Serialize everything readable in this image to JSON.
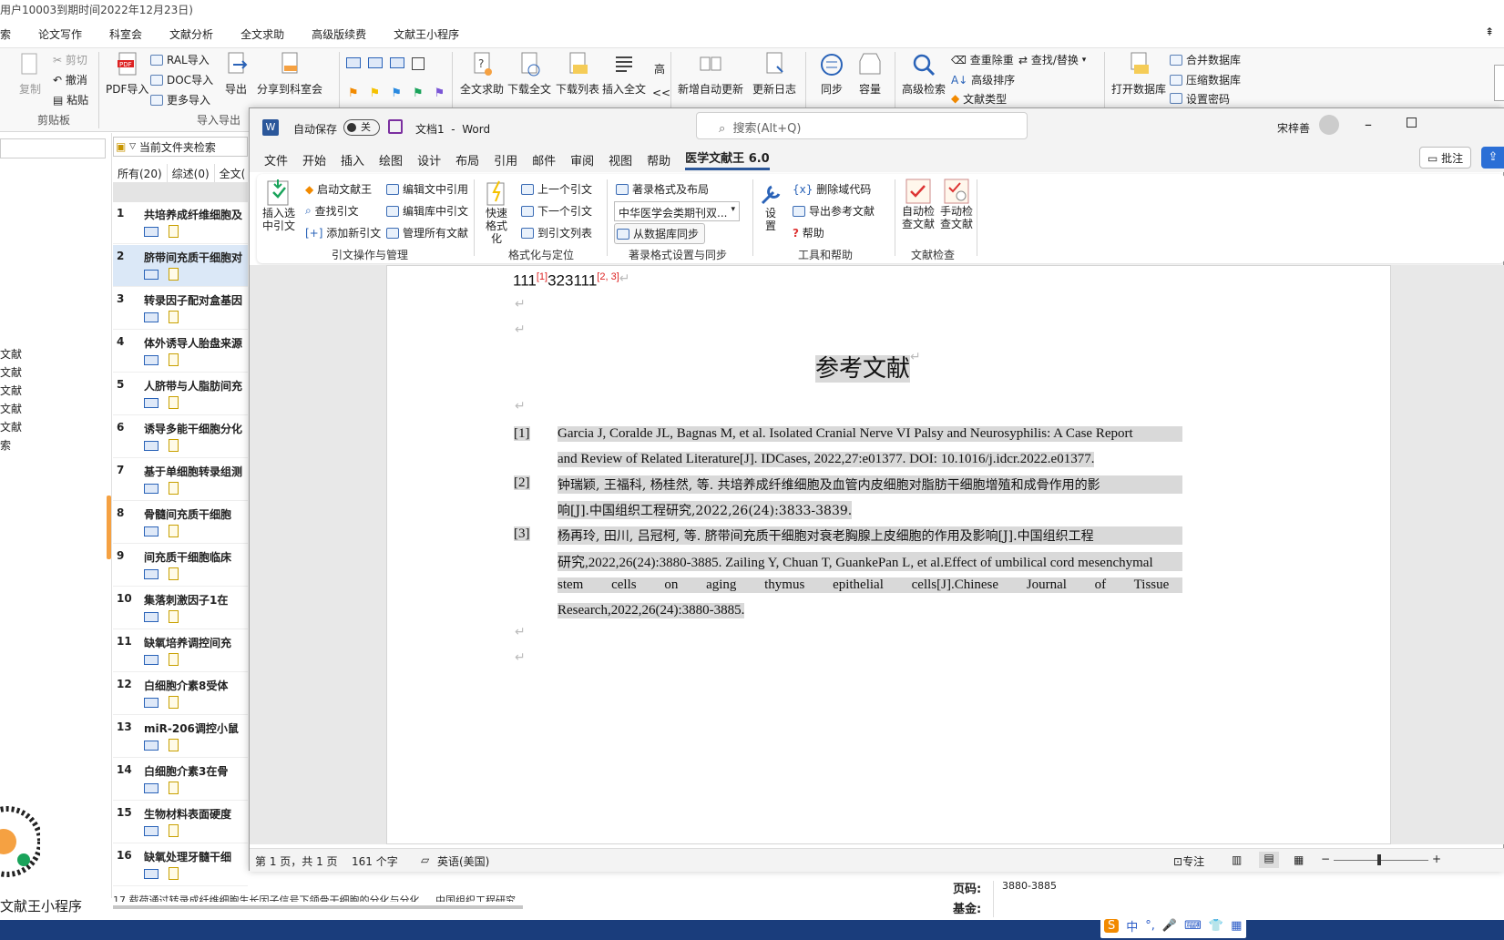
{
  "bg": {
    "title": "用户10003到期时间2022年12月23日)",
    "menu": [
      "索",
      "论文写作",
      "科室会",
      "文献分析",
      "全文求助",
      "高级版续费",
      "文献王小程序"
    ],
    "ribbon": {
      "clip": {
        "cut": "剪切",
        "undo": "撤消",
        "paste": "粘贴",
        "copy": "复制",
        "group": "剪贴板"
      },
      "import": {
        "pdf": "PDF导入",
        "ral": "RAL导入",
        "doc": "DOC导入",
        "more": "更多导入",
        "export": "导出",
        "share": "分享到科室会",
        "group": "导入导出"
      },
      "tools": {
        "fulltext_help": "全文求助",
        "download_full": "下载全文",
        "download_list": "下载列表",
        "insert_full": "插入全文",
        "high": "高",
        "arrows": "<<",
        "auto_update": "新增自动更新",
        "update_log": "更新日志",
        "sync": "同步",
        "capacity": "容量",
        "adv_search": "高级检索",
        "dedup": "查重除重",
        "find_replace": "查找/替换",
        "adv_sort": "高级排序",
        "doc_type": "文献类型",
        "open_db": "打开数据库",
        "merge_db": "合并数据库",
        "compress_db": "压缩数据库",
        "set_pwd": "设置密码"
      }
    },
    "left_items": [
      "文献",
      "文献",
      "文献",
      "文献",
      "文献",
      "索"
    ],
    "miniprogram": "文献王小程序",
    "folder_filter": "当前文件夹检索",
    "filter_tabs": [
      "所有(20)",
      "综述(0)",
      "全文("
    ],
    "rows": [
      {
        "num": "1",
        "title": "共培养成纤维细胞及"
      },
      {
        "num": "2",
        "title": "脐带间充质干细胞对"
      },
      {
        "num": "3",
        "title": "转录因子配对盒基因"
      },
      {
        "num": "4",
        "title": "体外诱导人胎盘来源"
      },
      {
        "num": "5",
        "title": "人脐带与人脂肪间充"
      },
      {
        "num": "6",
        "title": "诱导多能干细胞分化"
      },
      {
        "num": "7",
        "title": "基于单细胞转录组测"
      },
      {
        "num": "8",
        "title": "骨髓间充质干细胞"
      },
      {
        "num": "9",
        "title": "间充质干细胞临床"
      },
      {
        "num": "10",
        "title": "集落刺激因子1在"
      },
      {
        "num": "11",
        "title": "缺氧培养调控间充"
      },
      {
        "num": "12",
        "title": "白细胞介素8受体"
      },
      {
        "num": "13",
        "title": "miR-206调控小鼠"
      },
      {
        "num": "14",
        "title": "白细胞介素3在骨"
      },
      {
        "num": "15",
        "title": "生物材料表面硬度"
      },
      {
        "num": "16",
        "title": "缺氧处理牙髓干细"
      }
    ],
    "bottom_row_text": "17  载荷通过转录成纤维细胞生长因子信号下颌骨干细胞的分化与分化  ...  中国组织工程研究",
    "detail": {
      "pages_label": "页码:",
      "pages_value": "3880-3885",
      "fund_label": "基金:"
    }
  },
  "word": {
    "autosave": "自动保存",
    "toggle": "关",
    "docname": "文档1",
    "app": "Word",
    "search_placeholder": "搜索(Alt+Q)",
    "user": "宋梓善",
    "tabs": [
      "文件",
      "开始",
      "插入",
      "绘图",
      "设计",
      "布局",
      "引用",
      "邮件",
      "审阅",
      "视图",
      "帮助",
      "医学文献王 6.0"
    ],
    "comment_btn": "批注",
    "ribbon": {
      "insert_cite": "插入选中引文",
      "start_wxw": "启动文献王",
      "find_cite": "查找引文",
      "add_cite": "添加新引文",
      "edit_doc_cite": "编辑文中引用",
      "edit_lib_cite": "编辑库中引文",
      "manage_all": "管理所有文献",
      "group1": "引文操作与管理",
      "quick_format": "快速格式化",
      "prev_cite": "上一个引文",
      "next_cite": "下一个引文",
      "to_list": "到引文列表",
      "group2": "格式化与定位",
      "format_layout": "著录格式及布局",
      "style_select": "中华医学会类期刊双...",
      "sync_from_db": "从数据库同步",
      "group3": "著录格式设置与同步",
      "settings": "设置",
      "del_field": "删除域代码",
      "export_refs": "导出参考文献",
      "help": "帮助",
      "group4": "工具和帮助",
      "auto_check": "自动检查文献",
      "manual_check": "手动检查文献",
      "group5": "文献检查"
    },
    "doc": {
      "line1_a": "111",
      "cite1": "[1]",
      "line1_b": "323111",
      "cite2": "[2, 3]",
      "heading": "参考文献",
      "refs": [
        {
          "num": "[1]",
          "l1": "Garcia J, Coralde JL, Bagnas M, et al. Isolated Cranial Nerve VI Palsy and Neurosyphilis: A Case Report",
          "l2": "and Review of Related Literature[J]. IDCases, 2022,27:e01377. DOI: 10.1016/j.idcr.2022.e01377."
        },
        {
          "num": "[2]",
          "l1": "钟瑞颖, 王福科, 杨桂然, 等. 共培养成纤维细胞及血管内皮细胞对脂肪干细胞增殖和成骨作用的影",
          "l2": "响[J].中国组织工程研究,2022,26(24):3833-3839."
        },
        {
          "num": "[3]",
          "l1": "杨再玲, 田川, 吕冠柯, 等. 脐带间充质干细胞对衰老胸腺上皮细胞的作用及影响[J].中国组织工程",
          "l2": "研究,2022,26(24):3880-3885. Zailing Y, Chuan T, GuankePan L, et al.Effect of umbilical cord mesenchymal",
          "l3": "stem cells on aging thymus epithelial cells[J].Chinese Journal of Tissue Engineering",
          "l4": "Research,2022,26(24):3880-3885."
        }
      ]
    },
    "status": {
      "page": "第 1 页，共 1 页",
      "words": "161 个字",
      "lang": "英语(美国)",
      "focus": "专注"
    }
  },
  "tray": [
    "中",
    "°,",
    "🎤",
    "⌨",
    "👕",
    "▦"
  ]
}
